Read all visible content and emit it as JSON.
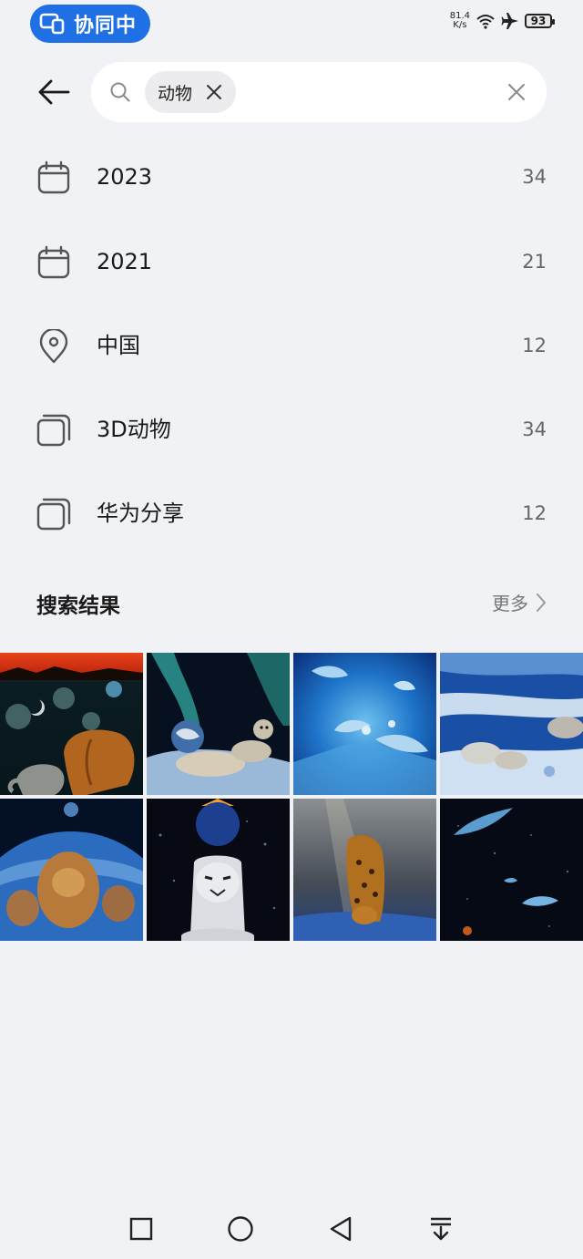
{
  "status_bar": {
    "collab_label": "协同中",
    "speed_value": "81.4",
    "speed_unit": "K/s",
    "battery": "93"
  },
  "search": {
    "chip_label": "动物"
  },
  "suggestions": [
    {
      "icon": "calendar-icon",
      "label": "2023",
      "count": "34"
    },
    {
      "icon": "calendar-icon",
      "label": "2021",
      "count": "21"
    },
    {
      "icon": "location-pin-icon",
      "label": "中国",
      "count": "12"
    },
    {
      "icon": "album-icon",
      "label": "3D动物",
      "count": "34"
    },
    {
      "icon": "album-icon",
      "label": "华为分享",
      "count": "12"
    }
  ],
  "results": {
    "title": "搜索结果",
    "more_label": "更多"
  },
  "colors": {
    "accent": "#1f6fe5",
    "background": "#f0f2f5"
  }
}
